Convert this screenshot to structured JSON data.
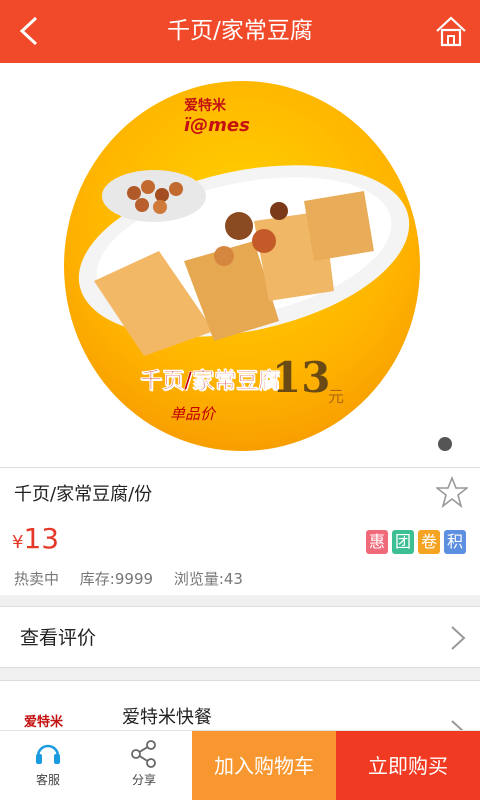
{
  "header": {
    "title": "千页/家常豆腐"
  },
  "hero": {
    "logo_brand": "爱特米",
    "logo_sub": "ï@mes",
    "dish_label": "千页/家常豆腐",
    "price_value": "13",
    "price_unit": "元",
    "script_text": "单品价"
  },
  "product": {
    "name": "千页/家常豆腐/份",
    "currency": "¥",
    "price": "13",
    "tags": [
      {
        "text": "惠",
        "color": "#f06a7a"
      },
      {
        "text": "团",
        "color": "#3cbf94"
      },
      {
        "text": "卷",
        "color": "#f5a323"
      },
      {
        "text": "积",
        "color": "#5d8fe0"
      }
    ],
    "status": "热卖中",
    "stock": "库存:9999",
    "views": "浏览量:43"
  },
  "review": {
    "label": "查看评价"
  },
  "store": {
    "logo_text": "爱特米",
    "name": "爱特米快餐"
  },
  "bottom_bar": {
    "service_label": "客服",
    "share_label": "分享",
    "add_cart_label": "加入购物车",
    "buy_now_label": "立即购买"
  },
  "colors": {
    "primary": "#f04a2a",
    "cart": "#f8972f",
    "buy": "#f03a22",
    "price": "#e53a2a"
  }
}
